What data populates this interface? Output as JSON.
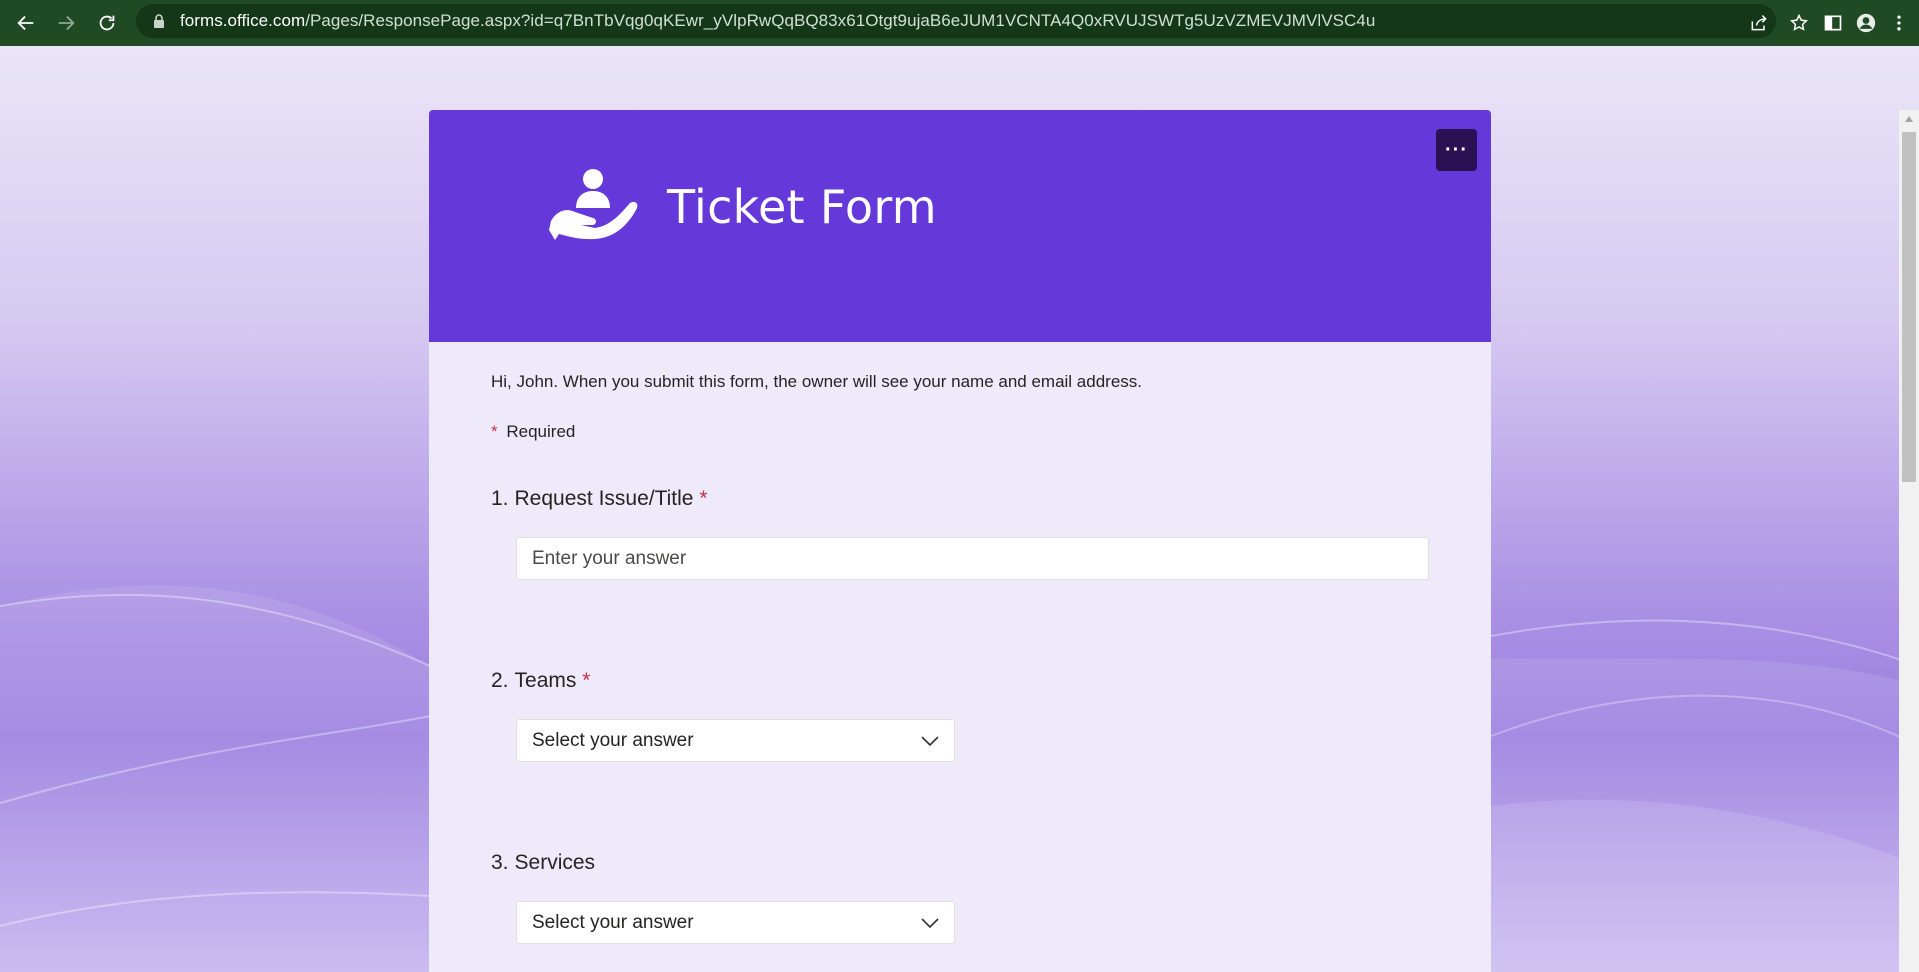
{
  "browser": {
    "url_domain": "forms.office.com",
    "url_path": "/Pages/ResponsePage.aspx?id=q7BnTbVqg0qKEwr_yVlpRwQqBQ83x61Otgt9ujaB6eJUM1VCNTA4Q0xRVUJSWTg5UzVZMEVJMVlVSC4u",
    "icons": [
      "back-icon",
      "forward-icon",
      "reload-icon",
      "lock-icon",
      "share-icon",
      "star-icon",
      "side-panel-icon",
      "profile-icon",
      "menu-icon"
    ]
  },
  "form": {
    "title": "Ticket Form",
    "more_button": "···",
    "intro": "Hi, John. When you submit this form, the owner will see your name and email address.",
    "required_star": "*",
    "required_label": "Required",
    "questions": [
      {
        "number": "1.",
        "label": "Request Issue/Title",
        "required_star": "*",
        "type": "text",
        "placeholder": "Enter your answer"
      },
      {
        "number": "2.",
        "label": "Teams",
        "required_star": "*",
        "type": "select",
        "value": "Select your answer"
      },
      {
        "number": "3.",
        "label": "Services",
        "type": "select",
        "value": "Select your answer"
      }
    ]
  },
  "colors": {
    "browser_toolbar": "#1f4a24",
    "header": "#6438d9",
    "card": "#efeaf9",
    "required": "#c4314b"
  }
}
